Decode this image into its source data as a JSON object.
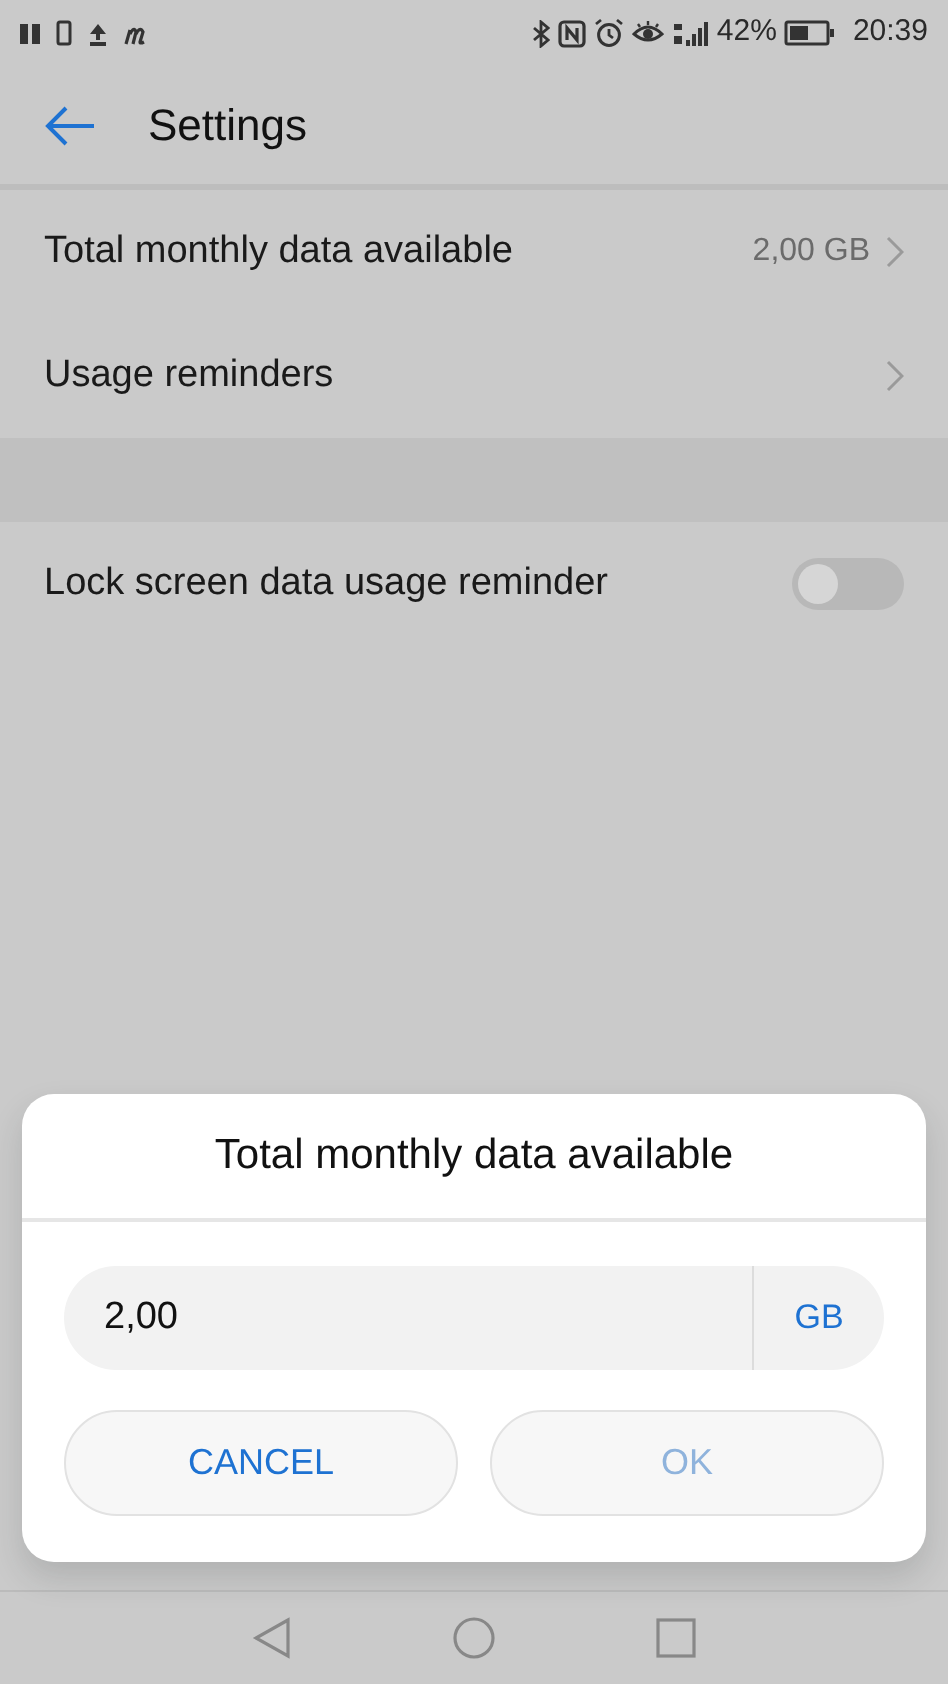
{
  "status_bar": {
    "battery_text": "42%",
    "time": "20:39"
  },
  "app_bar": {
    "title": "Settings"
  },
  "sections": [
    {
      "items": [
        {
          "kind": "link",
          "label": "Total monthly data available",
          "value": "2,00 GB"
        },
        {
          "kind": "link",
          "label": "Usage reminders"
        }
      ]
    },
    {
      "items": [
        {
          "kind": "switch",
          "label": "Lock screen data usage reminder",
          "on": false
        }
      ]
    }
  ],
  "dialog": {
    "title": "Total monthly data available",
    "input": {
      "value": "2,00"
    },
    "unit": "GB",
    "buttons": [
      {
        "label": "CANCEL",
        "disabled": false
      },
      {
        "label": "OK",
        "disabled": true
      }
    ]
  }
}
